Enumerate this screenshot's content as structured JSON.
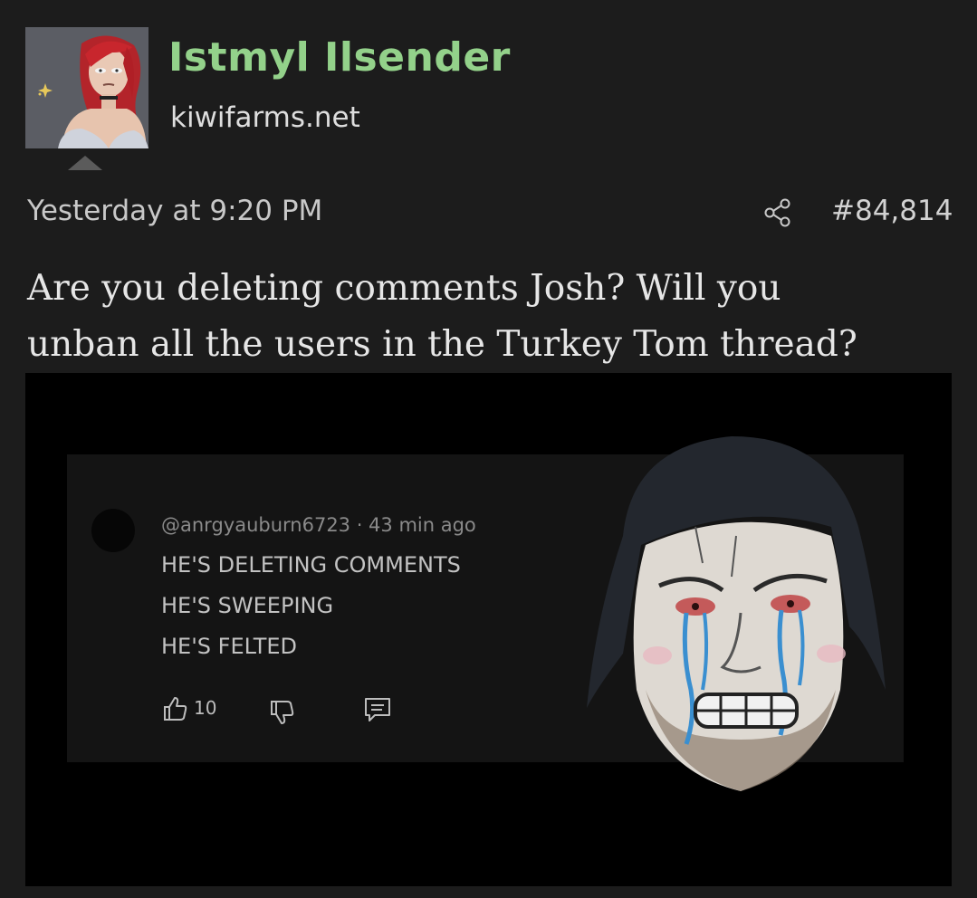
{
  "post": {
    "username": "Istmyl Ilsender",
    "site": "kiwifarms.net",
    "timestamp": "Yesterday at 9:20 PM",
    "post_number": "#84,814",
    "body_lines": [
      "Are you deleting comments Josh? Will you",
      "unban all the users in the Turkey Tom thread?"
    ],
    "username_color": "#93d18a"
  },
  "icons": {
    "share": "share-icon",
    "like": "thumbs-up-icon",
    "dislike": "thumbs-down-icon",
    "reply": "comment-icon",
    "more": "more-vertical-icon"
  },
  "embed": {
    "comment_meta": "@anrgyauburn6723 · 43 min ago",
    "lines": [
      "HE'S DELETING COMMENTS",
      "HE'S SWEEPING",
      "HE'S FELTED"
    ],
    "like_count": "10"
  }
}
